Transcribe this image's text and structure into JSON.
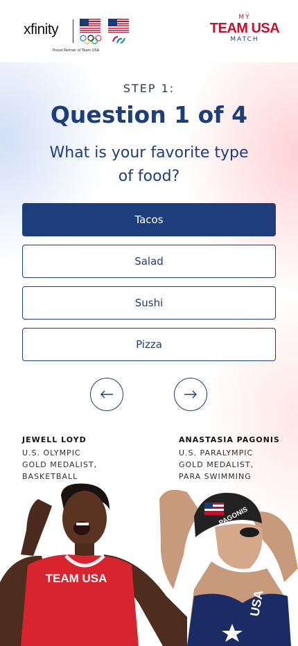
{
  "header": {
    "xfinity_logo": "xfinity",
    "partner_text": "Proud Partner of Team USA",
    "brand": {
      "my": "MY",
      "team": "TEAM USA",
      "match": "MATCH"
    }
  },
  "quiz": {
    "step": "STEP 1:",
    "title": "Question 1 of 4",
    "question": "What is your favorite type of food?",
    "options": [
      {
        "label": "Tacos",
        "selected": true
      },
      {
        "label": "Salad",
        "selected": false
      },
      {
        "label": "Sushi",
        "selected": false
      },
      {
        "label": "Pizza",
        "selected": false
      }
    ]
  },
  "navigation": {
    "prev_icon": "arrow-left-icon",
    "next_icon": "arrow-right-icon"
  },
  "athletes": [
    {
      "name": "JEWELL LOYD",
      "line1": "U.S. OLYMPIC",
      "line2": "GOLD MEDALIST,",
      "line3": "BASKETBALL",
      "jersey_text": "TEAM USA"
    },
    {
      "name": "ANASTASIA PAGONIS",
      "line1": "U.S. PARALYMPIC",
      "line2": "GOLD MEDALIST,",
      "line3": "PARA SWIMMING",
      "cap_text": "PAGONIS",
      "suit_text": "USA"
    }
  ],
  "colors": {
    "navy": "#1d3e7a",
    "red": "#c8102e",
    "white": "#ffffff"
  }
}
